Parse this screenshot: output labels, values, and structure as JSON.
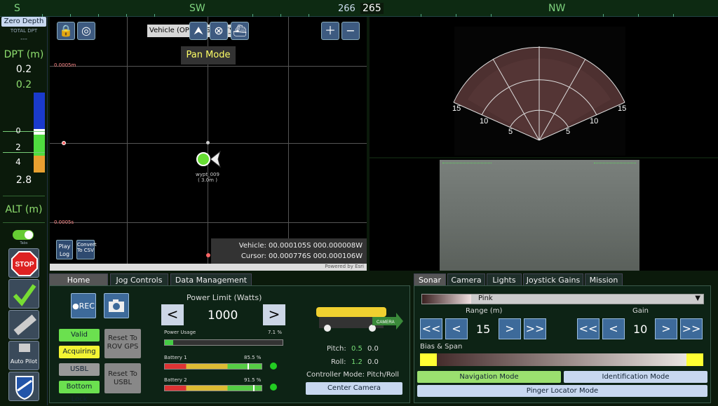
{
  "compass": {
    "s": "S",
    "sw": "SW",
    "nw": "NW",
    "heading_left": "266",
    "heading_current": "265"
  },
  "left": {
    "zero_depth": "Zero Depth",
    "total_dpt": "TOTAL DPT",
    "total_val": "---",
    "dpt_label": "DPT (m)",
    "dpt_val1": "0.2",
    "dpt_val2": "0.2",
    "scale_0": "0",
    "scale_2": "2",
    "scale_4": "4",
    "depth_val": "2.8",
    "alt_label": "ALT (m)",
    "tabs_label": "Tabs",
    "stop": "STOP",
    "autopilot": "Auto Pilot"
  },
  "map": {
    "vehicle_select": "Vehicle (OPENINS_NAV_",
    "pan_mode": "Pan Mode",
    "scale_top": "0.0005m",
    "scale_bottom": "0.0005s",
    "waypoint": "wypt_009",
    "waypoint_range": "( 3.0m )",
    "vehicle_coord": "Vehicle: 00.000105S 000.000008W",
    "cursor_coord": "Cursor: 00.000776S 000.000106W",
    "play_log": "Play Log",
    "convert_csv": "Convert To CSV",
    "powered": "Powered by Esri"
  },
  "sonar_labels": {
    "l15": "15",
    "l10": "10",
    "l5": "5",
    "r5": "5",
    "r10": "10",
    "r15": "15"
  },
  "left_tabs": [
    "Home",
    "Jog Controls",
    "Data Management"
  ],
  "home": {
    "rec": "●REC",
    "valid": "Valid",
    "acquiring": "Acquiring",
    "usbl": "USBL",
    "bottom_lock": "Bottom Lock",
    "reset_gps": "Reset To ROV GPS",
    "reset_usbl": "Reset To USBL",
    "power_limit_title": "Power Limit (Watts)",
    "power_limit": "1000",
    "power_usage": "Power Usage",
    "power_usage_val": "7.1 %",
    "power_usage_pct": 7.1,
    "battery1": "Battery 1",
    "battery1_val": "85.5 %",
    "battery1_pct": 85.5,
    "battery2": "Battery 2",
    "battery2_val": "91.5 %",
    "battery2_pct": 91.5,
    "camera_tag": "CAMERA",
    "pitch_label": "Pitch:",
    "pitch_val": "0.5",
    "pitch_val2": "0.0",
    "roll_label": "Roll:",
    "roll_val": "1.2",
    "roll_val2": "0.0",
    "controller_mode": "Controller Mode: Pitch/Roll",
    "center_camera": "Center Camera"
  },
  "right_tabs": [
    "Sonar",
    "Camera",
    "Lights",
    "Joystick Gains",
    "Mission"
  ],
  "sonar": {
    "palette": "Pink",
    "range_label": "Range (m)",
    "range_val": "15",
    "gain_label": "Gain",
    "gain_val": "10",
    "bias_span": "Bias & Span",
    "nav_mode": "Navigation Mode",
    "ident_mode": "Identification Mode",
    "pinger_mode": "Pinger Locator Mode",
    "btn_ll": "<<",
    "btn_l": "<",
    "btn_r": ">",
    "btn_rr": ">>"
  }
}
